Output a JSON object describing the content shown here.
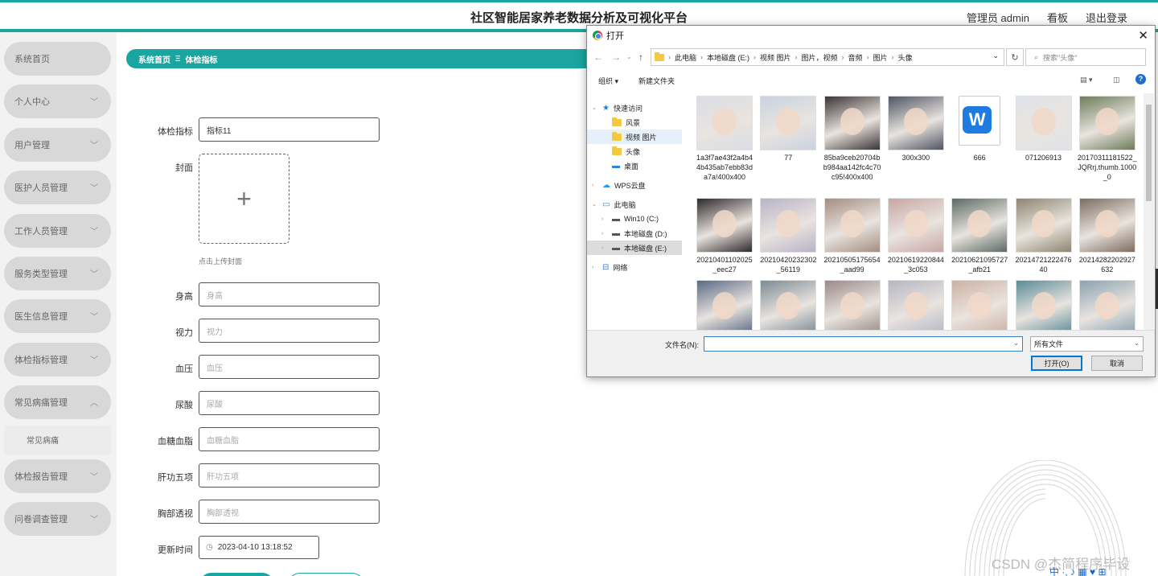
{
  "header": {
    "title": "社区智能居家养老数据分析及可视化平台",
    "admin_label": "管理员 admin",
    "board_label": "看板",
    "logout_label": "退出登录"
  },
  "sidebar": {
    "items": [
      {
        "label": "系统首页",
        "has_children": false
      },
      {
        "label": "个人中心",
        "has_children": true
      },
      {
        "label": "用户管理",
        "has_children": true
      },
      {
        "label": "医护人员管理",
        "has_children": true
      },
      {
        "label": "工作人员管理",
        "has_children": true
      },
      {
        "label": "服务类型管理",
        "has_children": true
      },
      {
        "label": "医生信息管理",
        "has_children": true
      },
      {
        "label": "体检指标管理",
        "has_children": true
      },
      {
        "label": "常见病痛管理",
        "has_children": true,
        "expanded": true
      },
      {
        "label": "体检报告管理",
        "has_children": true
      },
      {
        "label": "问卷调查管理",
        "has_children": true
      }
    ],
    "submenu_item": "常见病痛"
  },
  "breadcrumb": {
    "home": "系统首页",
    "separator": "Ξ",
    "current": "体检指标"
  },
  "form": {
    "indicator_label": "体检指标",
    "indicator_value": "指标11",
    "cover_label": "封面",
    "cover_hint": "点击上传封面",
    "fields": [
      {
        "label": "身高",
        "placeholder": "身高"
      },
      {
        "label": "视力",
        "placeholder": "视力"
      },
      {
        "label": "血压",
        "placeholder": "血压"
      },
      {
        "label": "尿酸",
        "placeholder": "尿酸"
      },
      {
        "label": "血糖血脂",
        "placeholder": "血糖血脂"
      },
      {
        "label": "肝功五项",
        "placeholder": "肝功五项"
      },
      {
        "label": "胸部透视",
        "placeholder": "胸部透视"
      }
    ],
    "update_time_label": "更新时间",
    "update_time_value": "2023-04-10 13:18:52"
  },
  "watermark": "CSDN @杰简程序毕设",
  "tray_text": "中 ·, ♪ ▦ ♥ ⊞",
  "dialog": {
    "title": "打开",
    "path": [
      "此电脑",
      "本地磁盘 (E:)",
      "视频 图片",
      "图片，视频",
      "音频",
      "图片",
      "头像"
    ],
    "search_placeholder": "搜索\"头像\"",
    "organize_label": "组织 ▾",
    "new_folder_label": "新建文件夹",
    "tree": [
      {
        "label": "快速访问",
        "icon": "star-icon",
        "level": 0,
        "expanded": true
      },
      {
        "label": "风景",
        "icon": "folder-icon",
        "level": 1
      },
      {
        "label": "视频 图片",
        "icon": "folder-icon",
        "level": 1,
        "hover": true
      },
      {
        "label": "头像",
        "icon": "folder-icon",
        "level": 1
      },
      {
        "label": "桌面",
        "icon": "desktop-icon",
        "level": 1
      },
      {
        "label": "WPS云盘",
        "icon": "cloud-icon",
        "level": 0
      },
      {
        "label": "此电脑",
        "icon": "computer-icon",
        "level": 0,
        "expanded": true
      },
      {
        "label": "Win10 (C:)",
        "icon": "drive-icon",
        "level": 1
      },
      {
        "label": "本地磁盘 (D:)",
        "icon": "drive-icon",
        "level": 1
      },
      {
        "label": "本地磁盘 (E:)",
        "icon": "drive-icon",
        "level": 1,
        "selected": true
      },
      {
        "label": "网络",
        "icon": "network-icon",
        "level": 0
      }
    ],
    "files": [
      {
        "name": "1a3f7ae43f2a4b44b435ab7ebb83da7a!400x400",
        "color": "#d9dde4"
      },
      {
        "name": "77",
        "color": "#c9d3e0"
      },
      {
        "name": "85ba9ceb20704bb984aa142fc4c70c95!400x400",
        "color": "#3a3436"
      },
      {
        "name": "300x300",
        "color": "#4f5562"
      },
      {
        "name": "666",
        "color": "wps"
      },
      {
        "name": "071206913",
        "color": "#dfe3e8"
      },
      {
        "name": "20170311181522_JQRrj.thumb.1000_0",
        "color": "#6d7c5a"
      },
      {
        "name": "20210401102025_eec27",
        "color": "#2e2a2c"
      },
      {
        "name": "20210420232302_56119",
        "color": "#b8b3c6"
      },
      {
        "name": "20210505175654_aad99",
        "color": "#a48d80"
      },
      {
        "name": "20210619220844_3c053",
        "color": "#c8a6a4"
      },
      {
        "name": "20210621095727_afb21",
        "color": "#5d6a64"
      },
      {
        "name": "2021472122247640",
        "color": "#8e8570"
      },
      {
        "name": "20214282202927632",
        "color": "#7d6d60"
      },
      {
        "name": "",
        "color": "#5b6a86"
      },
      {
        "name": "",
        "color": "#7c8b94"
      },
      {
        "name": "",
        "color": "#9a8a86"
      },
      {
        "name": "",
        "color": "#b6b6c4"
      },
      {
        "name": "",
        "color": "#cdb0a4"
      },
      {
        "name": "",
        "color": "#5a8c96"
      },
      {
        "name": "",
        "color": "#8aa2b0"
      }
    ],
    "filename_label": "文件名(N):",
    "filename_value": "",
    "filetype_value": "所有文件",
    "open_label": "打开(O)",
    "cancel_label": "取消"
  },
  "colors": {
    "accent": "#1aa5a0",
    "menu_bg": "#d8d8d8",
    "sidebar_bg": "#f2f2f2"
  }
}
